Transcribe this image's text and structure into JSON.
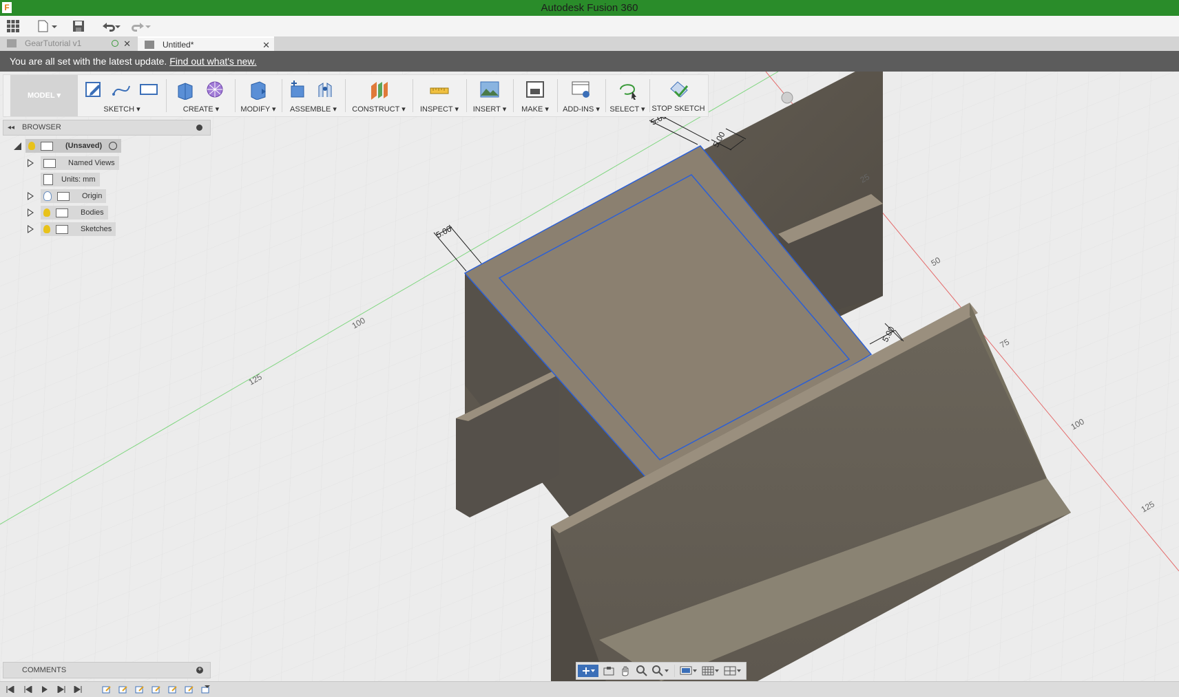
{
  "app": {
    "title": "Autodesk Fusion 360",
    "logo": "F"
  },
  "quick_access": {
    "items": [
      "apps-grid-icon",
      "file-icon",
      "save-icon",
      "undo-icon",
      "redo-icon"
    ]
  },
  "tabs": [
    {
      "label": "GearTutorial v1",
      "active": false,
      "close": "✕"
    },
    {
      "label": "Untitled*",
      "active": true,
      "close": "✕"
    }
  ],
  "notice": {
    "text": "You are all set with the latest update. ",
    "link": "Find out what's new."
  },
  "toolbar": {
    "workspace": "MODEL ▾",
    "groups": [
      {
        "id": "sketch",
        "label": "SKETCH ▾"
      },
      {
        "id": "create",
        "label": "CREATE ▾"
      },
      {
        "id": "modify",
        "label": "MODIFY ▾"
      },
      {
        "id": "assemble",
        "label": "ASSEMBLE ▾"
      },
      {
        "id": "construct",
        "label": "CONSTRUCT ▾"
      },
      {
        "id": "inspect",
        "label": "INSPECT ▾"
      },
      {
        "id": "insert",
        "label": "INSERT ▾"
      },
      {
        "id": "make",
        "label": "MAKE ▾"
      },
      {
        "id": "addins",
        "label": "ADD-INS ▾"
      },
      {
        "id": "select",
        "label": "SELECT ▾"
      },
      {
        "id": "stop",
        "label": "STOP SKETCH"
      }
    ]
  },
  "browser": {
    "title": "BROWSER",
    "root": "(Unsaved)",
    "items": [
      "Named Views",
      "Units: mm",
      "Origin",
      "Bodies",
      "Sketches"
    ]
  },
  "comments": {
    "title": "COMMENTS"
  },
  "viewport": {
    "dimensions": [
      "5.00",
      "5.00",
      "5.00",
      "5.00"
    ],
    "red_axis_ticks": [
      "25",
      "50",
      "75",
      "100",
      "125"
    ],
    "green_axis_ticks": [
      "100",
      "125"
    ],
    "colors": {
      "body_top": "#8b8070",
      "body_side": "#5a544b",
      "sketch_line": "#2b5fd6",
      "green_axis": "#7fd67f",
      "red_axis": "#e46a6a"
    }
  },
  "navbar": {
    "items": [
      "orbit-icon",
      "look-at-icon",
      "pan-icon",
      "zoom-icon",
      "zoom-window-icon",
      "display-settings-icon",
      "grid-icon",
      "viewports-icon"
    ]
  }
}
